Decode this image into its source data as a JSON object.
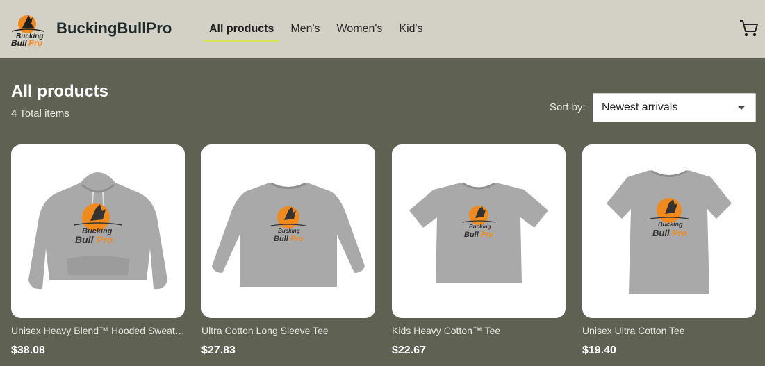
{
  "header": {
    "logo_line1": "Bucking",
    "logo_line2a": "Bull",
    "logo_line2b": "Pro",
    "brand": "BuckingBullPro",
    "nav": [
      "All products",
      "Men's",
      "Women's",
      "Kid's"
    ],
    "active_nav": "All products",
    "cart_icon": "cart-icon"
  },
  "main": {
    "title": "All products",
    "total": "4 Total items",
    "sort_label": "Sort by:",
    "sort_value": "Newest arrivals"
  },
  "products": [
    {
      "name": "Unisex Heavy Blend™ Hooded Sweatshirt",
      "price": "$38.08",
      "type": "hoodie"
    },
    {
      "name": "Ultra Cotton Long Sleeve Tee",
      "price": "$27.83",
      "type": "longsleeve"
    },
    {
      "name": "Kids Heavy Cotton™ Tee",
      "price": "$22.67",
      "type": "kids-tee"
    },
    {
      "name": "Unisex Ultra Cotton Tee",
      "price": "$19.40",
      "type": "tee"
    }
  ],
  "colors": {
    "header_bg": "#d3d1c6",
    "page_bg": "#5f6253",
    "accent_orange": "#f08a1c",
    "garment_gray": "#a9a9a9",
    "nav_underline": "#d8e25a"
  }
}
